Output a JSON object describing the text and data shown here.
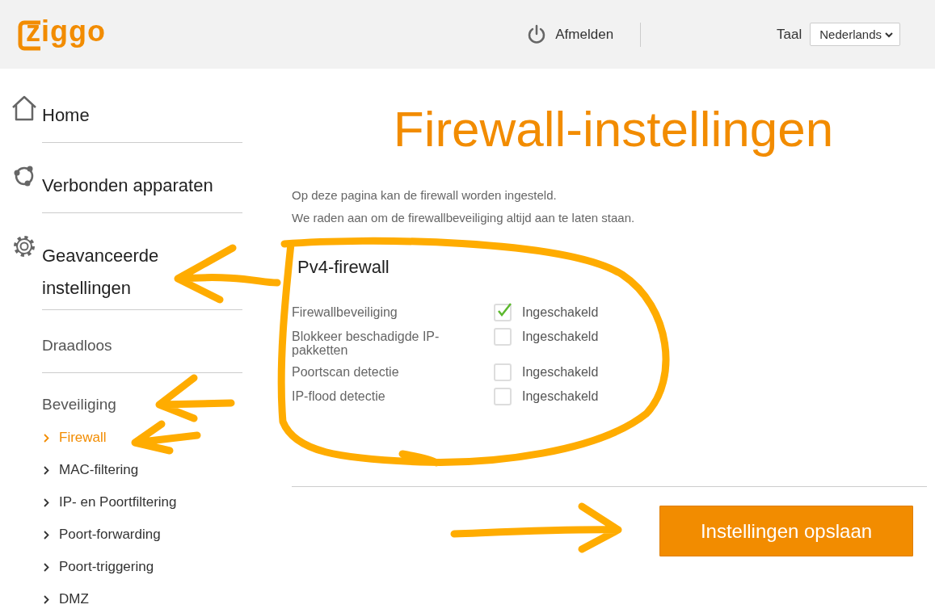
{
  "header": {
    "logo": "ziggo",
    "logout": "Afmelden",
    "language_label": "Taal",
    "language": "Nederlands"
  },
  "sidebar": {
    "main_items": [
      {
        "label": "Home",
        "kind": "home"
      },
      {
        "label": "Verbonden apparaten",
        "kind": "devices"
      },
      {
        "label": "Geavanceerde instellingen",
        "kind": "advanced"
      },
      {
        "label": "Draadloos",
        "kind": "plain"
      }
    ],
    "section": "Beveiliging",
    "sub_items": [
      {
        "label": "Firewall",
        "selected": true
      },
      {
        "label": "MAC-filtering",
        "selected": false
      },
      {
        "label": "IP- en Poortfiltering",
        "selected": false
      },
      {
        "label": "Poort-forwarding",
        "selected": false
      },
      {
        "label": "Poort-triggering",
        "selected": false
      },
      {
        "label": "DMZ",
        "selected": false
      }
    ]
  },
  "main": {
    "title": "Firewall-instellingen",
    "description": [
      "Op deze pagina kan de firewall worden ingesteld.",
      "We raden aan om de firewallbeveiliging altijd aan te laten staan."
    ],
    "section_title": "Pv4-firewall",
    "settings": [
      {
        "label": "Firewallbeveiliging",
        "checked": true,
        "option": "Ingeschakeld"
      },
      {
        "label": "Blokkeer beschadigde IP-pakketten",
        "checked": false,
        "option": "Ingeschakeld"
      },
      {
        "label": "Poortscan detectie",
        "checked": false,
        "option": "Ingeschakeld"
      },
      {
        "label": "IP-flood detectie",
        "checked": false,
        "option": "Ingeschakeld"
      }
    ],
    "save_button": "Instellingen opslaan"
  }
}
